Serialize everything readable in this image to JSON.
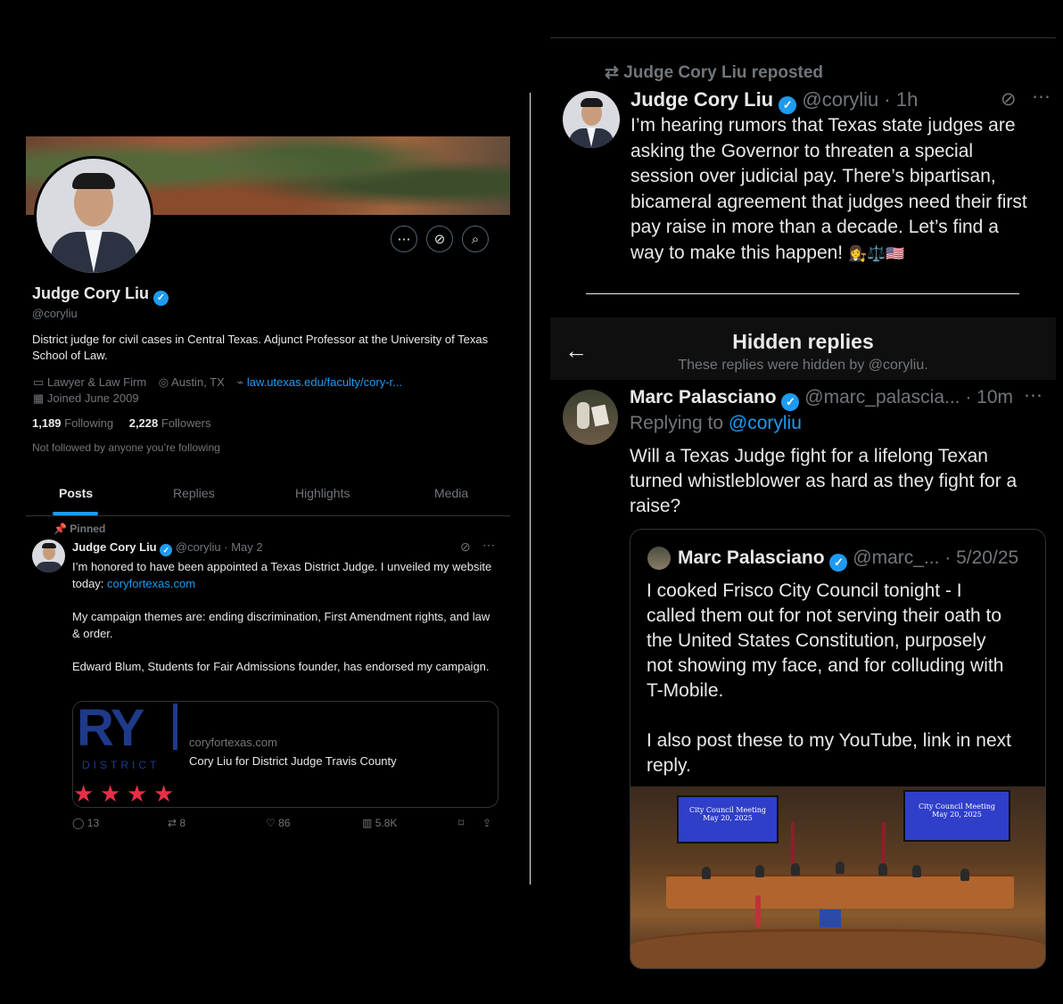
{
  "profile": {
    "name": "Judge Cory Liu",
    "handle": "@coryliu",
    "bio": "District judge for civil cases in Central Texas. Adjunct Professor at the University of Texas School of Law.",
    "category": "Lawyer & Law Firm",
    "location": "Austin, TX",
    "website": "law.utexas.edu/faculty/cory-r...",
    "joined": "Joined June 2009",
    "following_count": "1,189",
    "following_label": "Following",
    "followers_count": "2,228",
    "followers_label": "Followers",
    "followed_note": "Not followed by anyone you’re following"
  },
  "tabs": [
    "Posts",
    "Replies",
    "Highlights",
    "Media"
  ],
  "pinned_post": {
    "pinned_label": "Pinned",
    "author": "Judge Cory Liu",
    "handle_date": "@coryliu · May 2",
    "text1": "I’m honored to have been appointed a Texas District Judge. I unveiled my website today:",
    "link": "coryfortexas.com",
    "text2": "My campaign themes are: ending discrimination, First Amendment rights, and law & order.",
    "text3": "Edward Blum, Students for Fair Admissions founder, has endorsed my campaign.",
    "card": {
      "thumb_text": "RY",
      "thumb_sub": "DISTRICT",
      "domain": "coryfortexas.com",
      "title": "Cory Liu for District Judge Travis County"
    },
    "actions": {
      "replies": "13",
      "reposts": "8",
      "likes": "86",
      "views": "5.8K"
    }
  },
  "repost": {
    "label": "Judge Cory Liu reposted",
    "author": "Judge Cory Liu",
    "handle_time": "@coryliu · 1h",
    "lines": [
      "I’m hearing rumors that Texas state judges are",
      "asking the Governor to threaten a special",
      "session over judicial pay. There’s bipartisan,",
      "bicameral agreement that judges need their first",
      "pay raise in more than a decade. Let’s find a",
      "way to make this happen!"
    ],
    "emoji": "👩‍⚖️⚖️🇺🇸"
  },
  "hidden": {
    "title": "Hidden replies",
    "subtitle": "These replies were hidden by @coryliu."
  },
  "reply": {
    "author": "Marc Palasciano",
    "handle_time": "@marc_palascia... · 10m",
    "replying_prefix": "Replying to",
    "replying_handle": "@coryliu",
    "lines": [
      "Will a Texas Judge fight for a lifelong Texan",
      "turned whistleblower as hard as they fight for a",
      "raise?"
    ]
  },
  "quote": {
    "author": "Marc Palasciano",
    "handle_time": "@marc_... · 5/20/25",
    "lines": [
      "I cooked Frisco City Council tonight - I",
      "called them out for not serving their oath to",
      "the United States Constitution, purposely",
      "not showing my face, and for colluding with",
      "T-Mobile."
    ],
    "lines2": [
      "I also post these to my YouTube, link in next",
      "reply."
    ],
    "screen_title": "City Council Meeting",
    "screen_date": "May 20, 2025"
  }
}
